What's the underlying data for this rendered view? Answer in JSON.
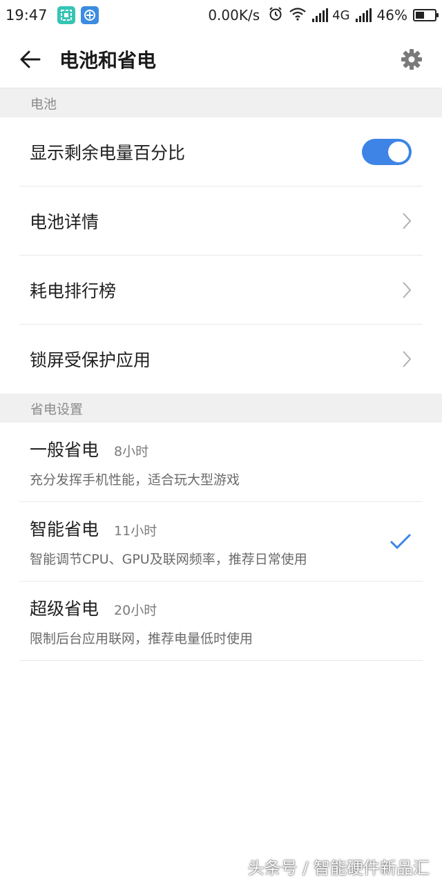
{
  "status_bar": {
    "time": "19:47",
    "speed": "0.00K/s",
    "network": "4G",
    "battery_pct": "46%",
    "battery_level": 0.46,
    "icons": [
      "screenshot-app-icon",
      "browser-app-icon",
      "alarm-icon",
      "wifi-icon",
      "signal-icon",
      "battery-icon"
    ]
  },
  "header": {
    "title": "电池和省电",
    "back_icon": "arrow-left-icon",
    "settings_icon": "gear-icon"
  },
  "battery_section": {
    "title": "电池",
    "items": [
      {
        "label": "显示剩余电量百分比",
        "type": "toggle",
        "checked": true
      },
      {
        "label": "电池详情",
        "type": "link",
        "icon": "chevron-right-icon"
      },
      {
        "label": "耗电排行榜",
        "type": "link",
        "icon": "chevron-right-icon"
      },
      {
        "label": "锁屏受保护应用",
        "type": "link",
        "icon": "chevron-right-icon"
      }
    ]
  },
  "power_section": {
    "title": "省电设置",
    "modes": [
      {
        "title": "一般省电",
        "hours": "8小时",
        "desc": "充分发挥手机性能，适合玩大型游戏",
        "selected": false
      },
      {
        "title": "智能省电",
        "hours": "11小时",
        "desc": "智能调节CPU、GPU及联网频率，推荐日常使用",
        "selected": true
      },
      {
        "title": "超级省电",
        "hours": "20小时",
        "desc": "限制后台应用联网，推荐电量低时使用",
        "selected": false
      }
    ]
  },
  "watermark": "头条号 / 智能硬件新品汇",
  "colors": {
    "accent": "#3d84e6",
    "section_bg": "#f0f0f0",
    "divider": "#e8e8e8"
  }
}
